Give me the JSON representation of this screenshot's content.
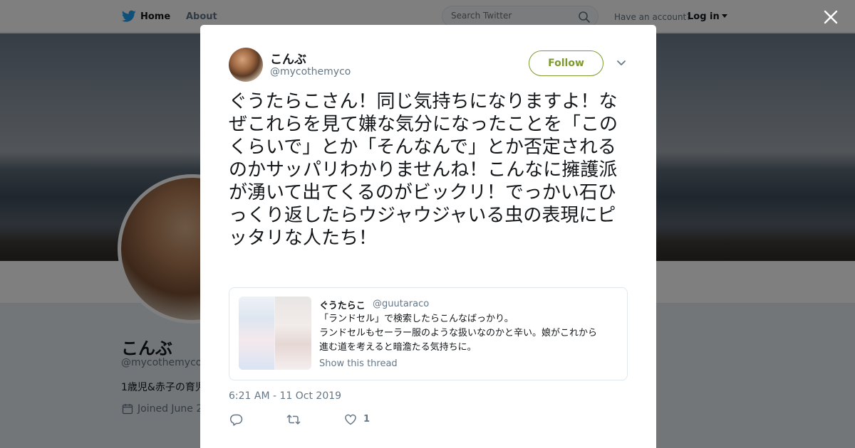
{
  "nav": {
    "home_label": "Home",
    "about_label": "About",
    "search_placeholder": "Search Twitter",
    "have_account": "Have an account?",
    "login_label": "Log in"
  },
  "profile": {
    "name": "こんぶ",
    "handle": "@mycothemyco",
    "bio": "1歳児&赤子の育児",
    "joined": "Joined June 2"
  },
  "tweet": {
    "author_name": "こんぶ",
    "author_handle": "@mycothemyco",
    "follow_label": "Follow",
    "text": "ぐうたらこさん！同じ気持ちになりますよ！なぜこれらを見て嫌な気分になったことを「このくらいで」とか「そんなんで」とか否定されるのかサッパリわかりませんね！こんなに擁護派が湧いて出てくるのがビックリ！でっかい石ひっくり返したらウジャウジャいる虫の表現にピッタリな人たち！",
    "timestamp": "6:21 AM - 11 Oct 2019",
    "like_count": "1",
    "quote": {
      "name": "ぐうたらこ",
      "handle": "@guutaraco",
      "lines": [
        "「ランドセル」で検索したらこんなばっかり。",
        "ランドセルもセーラー服のような扱いなのかと辛い。娘がこれから",
        "進む道を考えると暗澹たる気持ちに。"
      ],
      "show_thread": "Show this thread"
    }
  },
  "icons": [
    "twitter-bird-icon",
    "search-icon",
    "close-icon",
    "chevron-down-icon",
    "reply-icon",
    "retweet-icon",
    "heart-icon",
    "calendar-icon"
  ],
  "colors": {
    "follow_accent": "#7d9a2f",
    "twitter_blue": "#1da1f2",
    "muted_text": "#657786"
  }
}
